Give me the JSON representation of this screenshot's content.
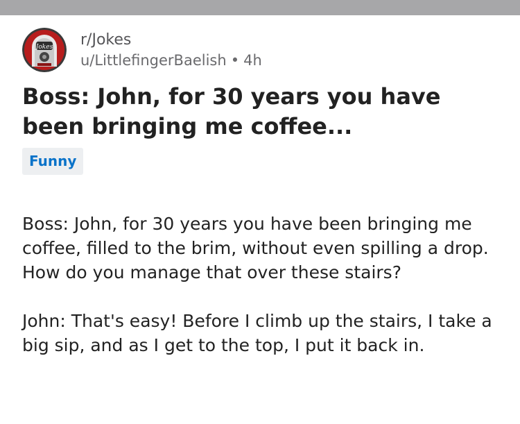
{
  "post": {
    "subreddit": "r/Jokes",
    "author": "u/LittlefingerBaelish",
    "separator": "•",
    "age": "4h",
    "title": "Boss: John, for 30 years you have been bringing me coffee...",
    "flair": "Funny",
    "body": [
      "Boss: John, for 30 years you have been bringing me coffee, filled to the brim, without even spilling a drop. How do you manage that over these stairs?",
      "John: That's easy! Before I climb up the stairs, I take a big sip, and as I get to the top, I put it back in."
    ]
  },
  "avatar": {
    "icon": "jokes-jukebox-icon",
    "logo_text": "Jokes"
  },
  "colors": {
    "top_bar": "#a7a7a9",
    "flair_text": "#0a73c9",
    "flair_bg": "#edeff1",
    "meta_text": "#6a6a6d"
  }
}
